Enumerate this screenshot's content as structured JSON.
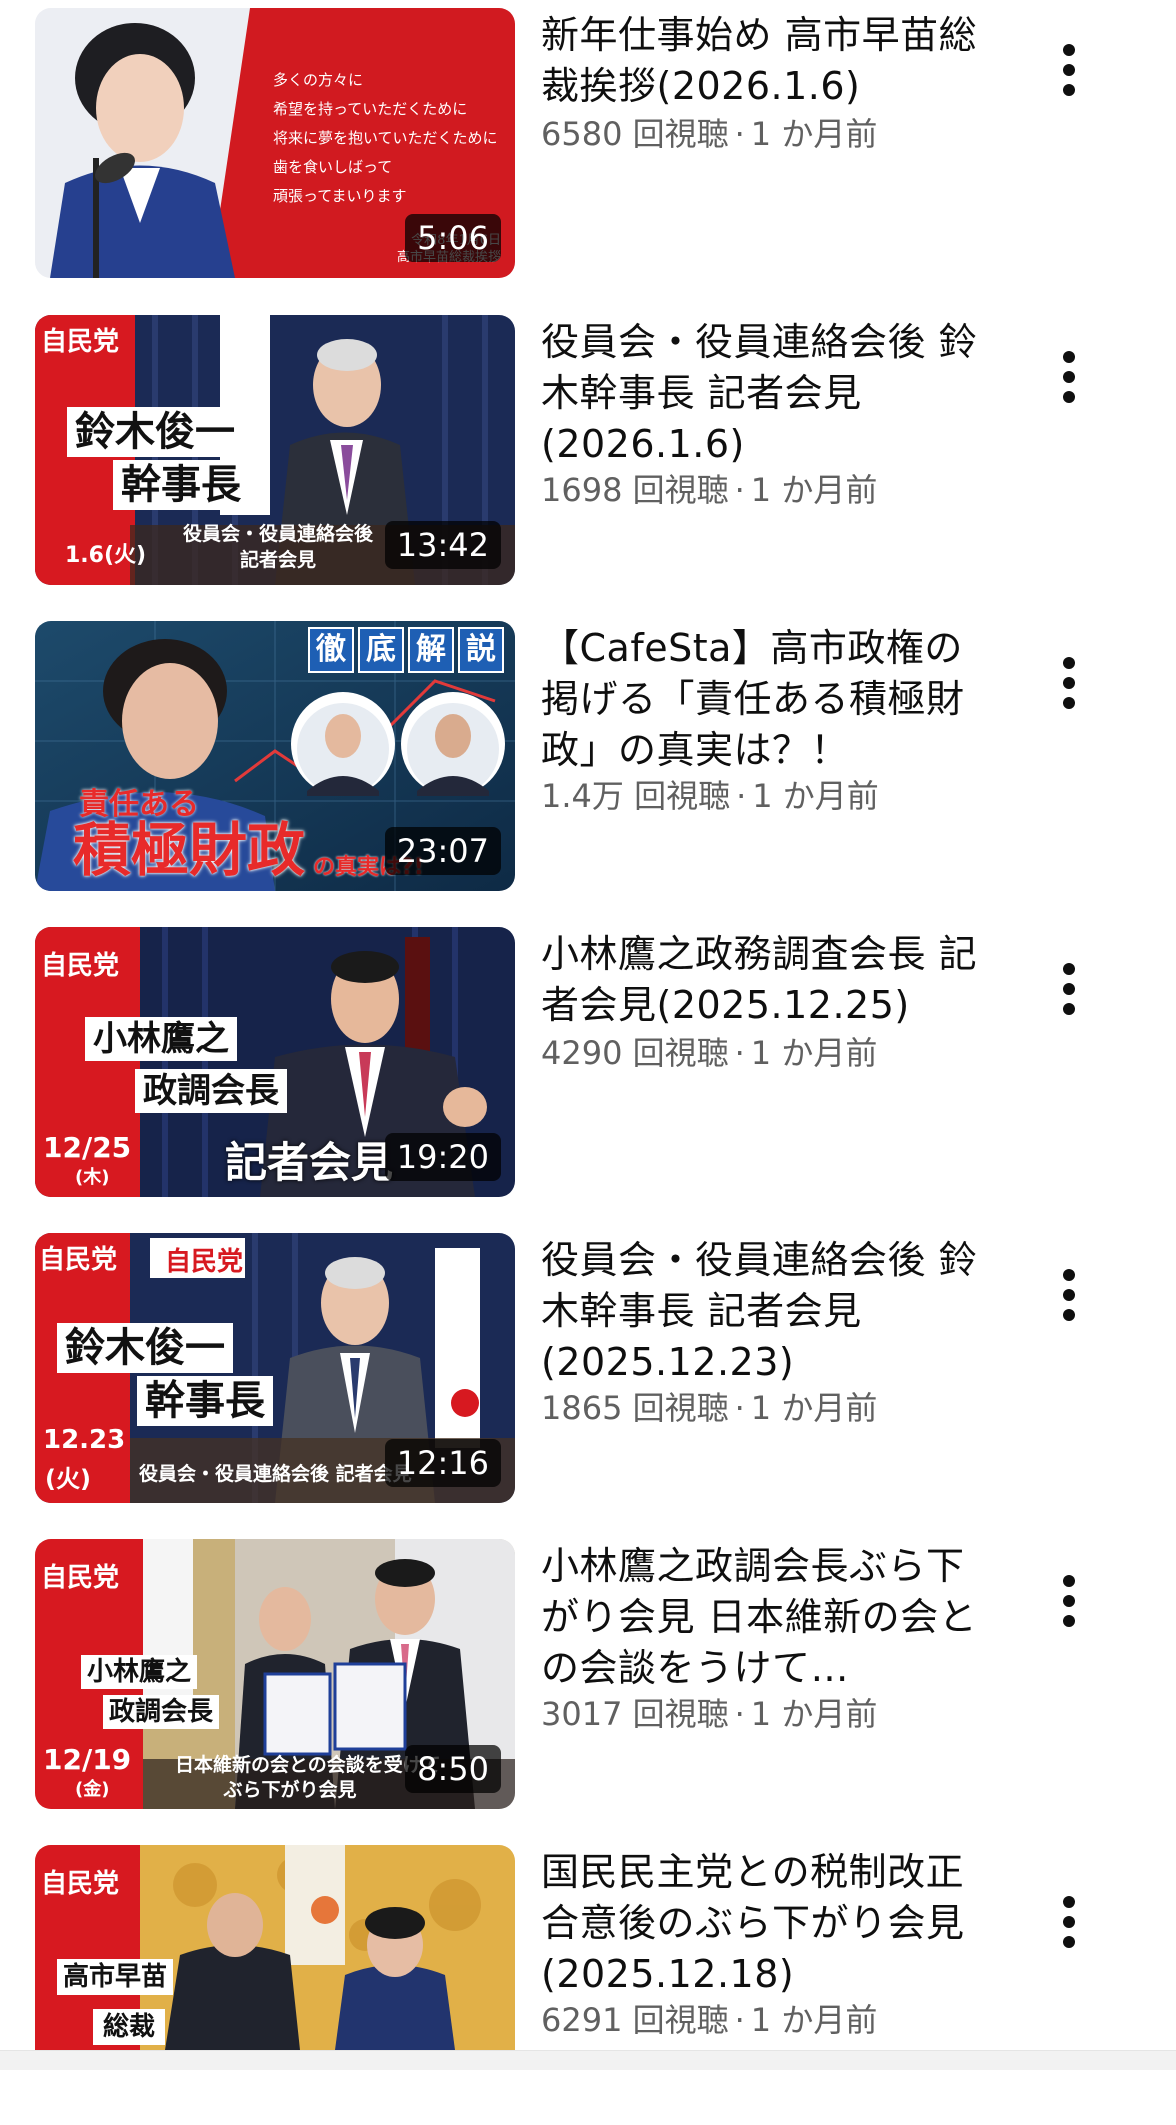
{
  "videos": [
    {
      "title": "新年仕事始め 高市早苗総裁挨拶(2026.1.6)",
      "views": "6580 回視聴",
      "separator": "·",
      "age": "1 か月前",
      "duration": "5:06",
      "menu_icon": "more-vert-icon",
      "thumb_text": {
        "quote_line1": "多くの方々に",
        "quote_line2": "希望を持っていただくために",
        "quote_line3": "将来に夢を抱いていただくために",
        "quote_line4": "歯を食いしばって",
        "quote_line5": "頑張ってまいります",
        "footer_line1": "令和8年1月6日",
        "footer_line2": "高市早苗総裁挨拶"
      }
    },
    {
      "title": "役員会・役員連絡会後 鈴木幹事長 記者会見(2026.1.6)",
      "views": "1698 回視聴",
      "separator": "·",
      "age": "1 か月前",
      "duration": "13:42",
      "menu_icon": "more-vert-icon",
      "thumb_text": {
        "party": "自民党",
        "name": "鈴木俊一",
        "role": "幹事長",
        "date": "1.6(火)",
        "caption_line1": "役員会・役員連絡会後",
        "caption_line2": "記者会見"
      }
    },
    {
      "title": "【CafeSta】高市政権の掲げる「責任ある積極財政」の真実は？！",
      "views": "1.4万 回視聴",
      "separator": "·",
      "age": "1 か月前",
      "duration": "23:07",
      "menu_icon": "more-vert-icon",
      "thumb_text": {
        "badge": [
          "徹",
          "底",
          "解",
          "説"
        ],
        "line_small": "責任ある",
        "line_big": "積極財政",
        "line_tail": "の真実は?!"
      }
    },
    {
      "title": "小林鷹之政務調査会長 記者会見(2025.12.25)",
      "views": "4290 回視聴",
      "separator": "·",
      "age": "1 か月前",
      "duration": "19:20",
      "menu_icon": "more-vert-icon",
      "thumb_text": {
        "party": "自民党",
        "name": "小林鷹之",
        "role": "政調会長",
        "date": "12/25",
        "weekday": "(木)",
        "caption": "記者会見"
      }
    },
    {
      "title": "役員会・役員連絡会後 鈴木幹事長 記者会見(2025.12.23)",
      "views": "1865 回視聴",
      "separator": "·",
      "age": "1 か月前",
      "duration": "12:16",
      "menu_icon": "more-vert-icon",
      "thumb_text": {
        "party": "自民党",
        "podium_logo": "自民党",
        "name": "鈴木俊一",
        "role": "幹事長",
        "date": "12.23",
        "weekday": "(火)",
        "caption": "役員会・役員連絡会後 記者会見"
      }
    },
    {
      "title": "小林鷹之政調会長ぶら下がり会見 日本維新の会との会談をうけて…",
      "views": "3017 回視聴",
      "separator": "·",
      "age": "1 か月前",
      "duration": "8:50",
      "menu_icon": "more-vert-icon",
      "thumb_text": {
        "party": "自民党",
        "name": "小林鷹之",
        "role": "政調会長",
        "date": "12/19",
        "weekday": "(金)",
        "caption_line1": "日本維新の会との会談を受けて",
        "caption_line2": "ぶら下がり会見"
      }
    },
    {
      "title": "国民民主党との税制改正合意後のぶら下がり会見(2025.12.18)",
      "views": "6291 回視聴",
      "separator": "·",
      "age": "1 か月前",
      "duration": "",
      "menu_icon": "more-vert-icon",
      "thumb_text": {
        "party": "自民党",
        "name": "高市早苗",
        "role": "総裁"
      }
    }
  ],
  "colors": {
    "title": "#0f0f0f",
    "meta": "#606060",
    "ldp_red": "#d71920",
    "navy": "#1b2a55"
  }
}
